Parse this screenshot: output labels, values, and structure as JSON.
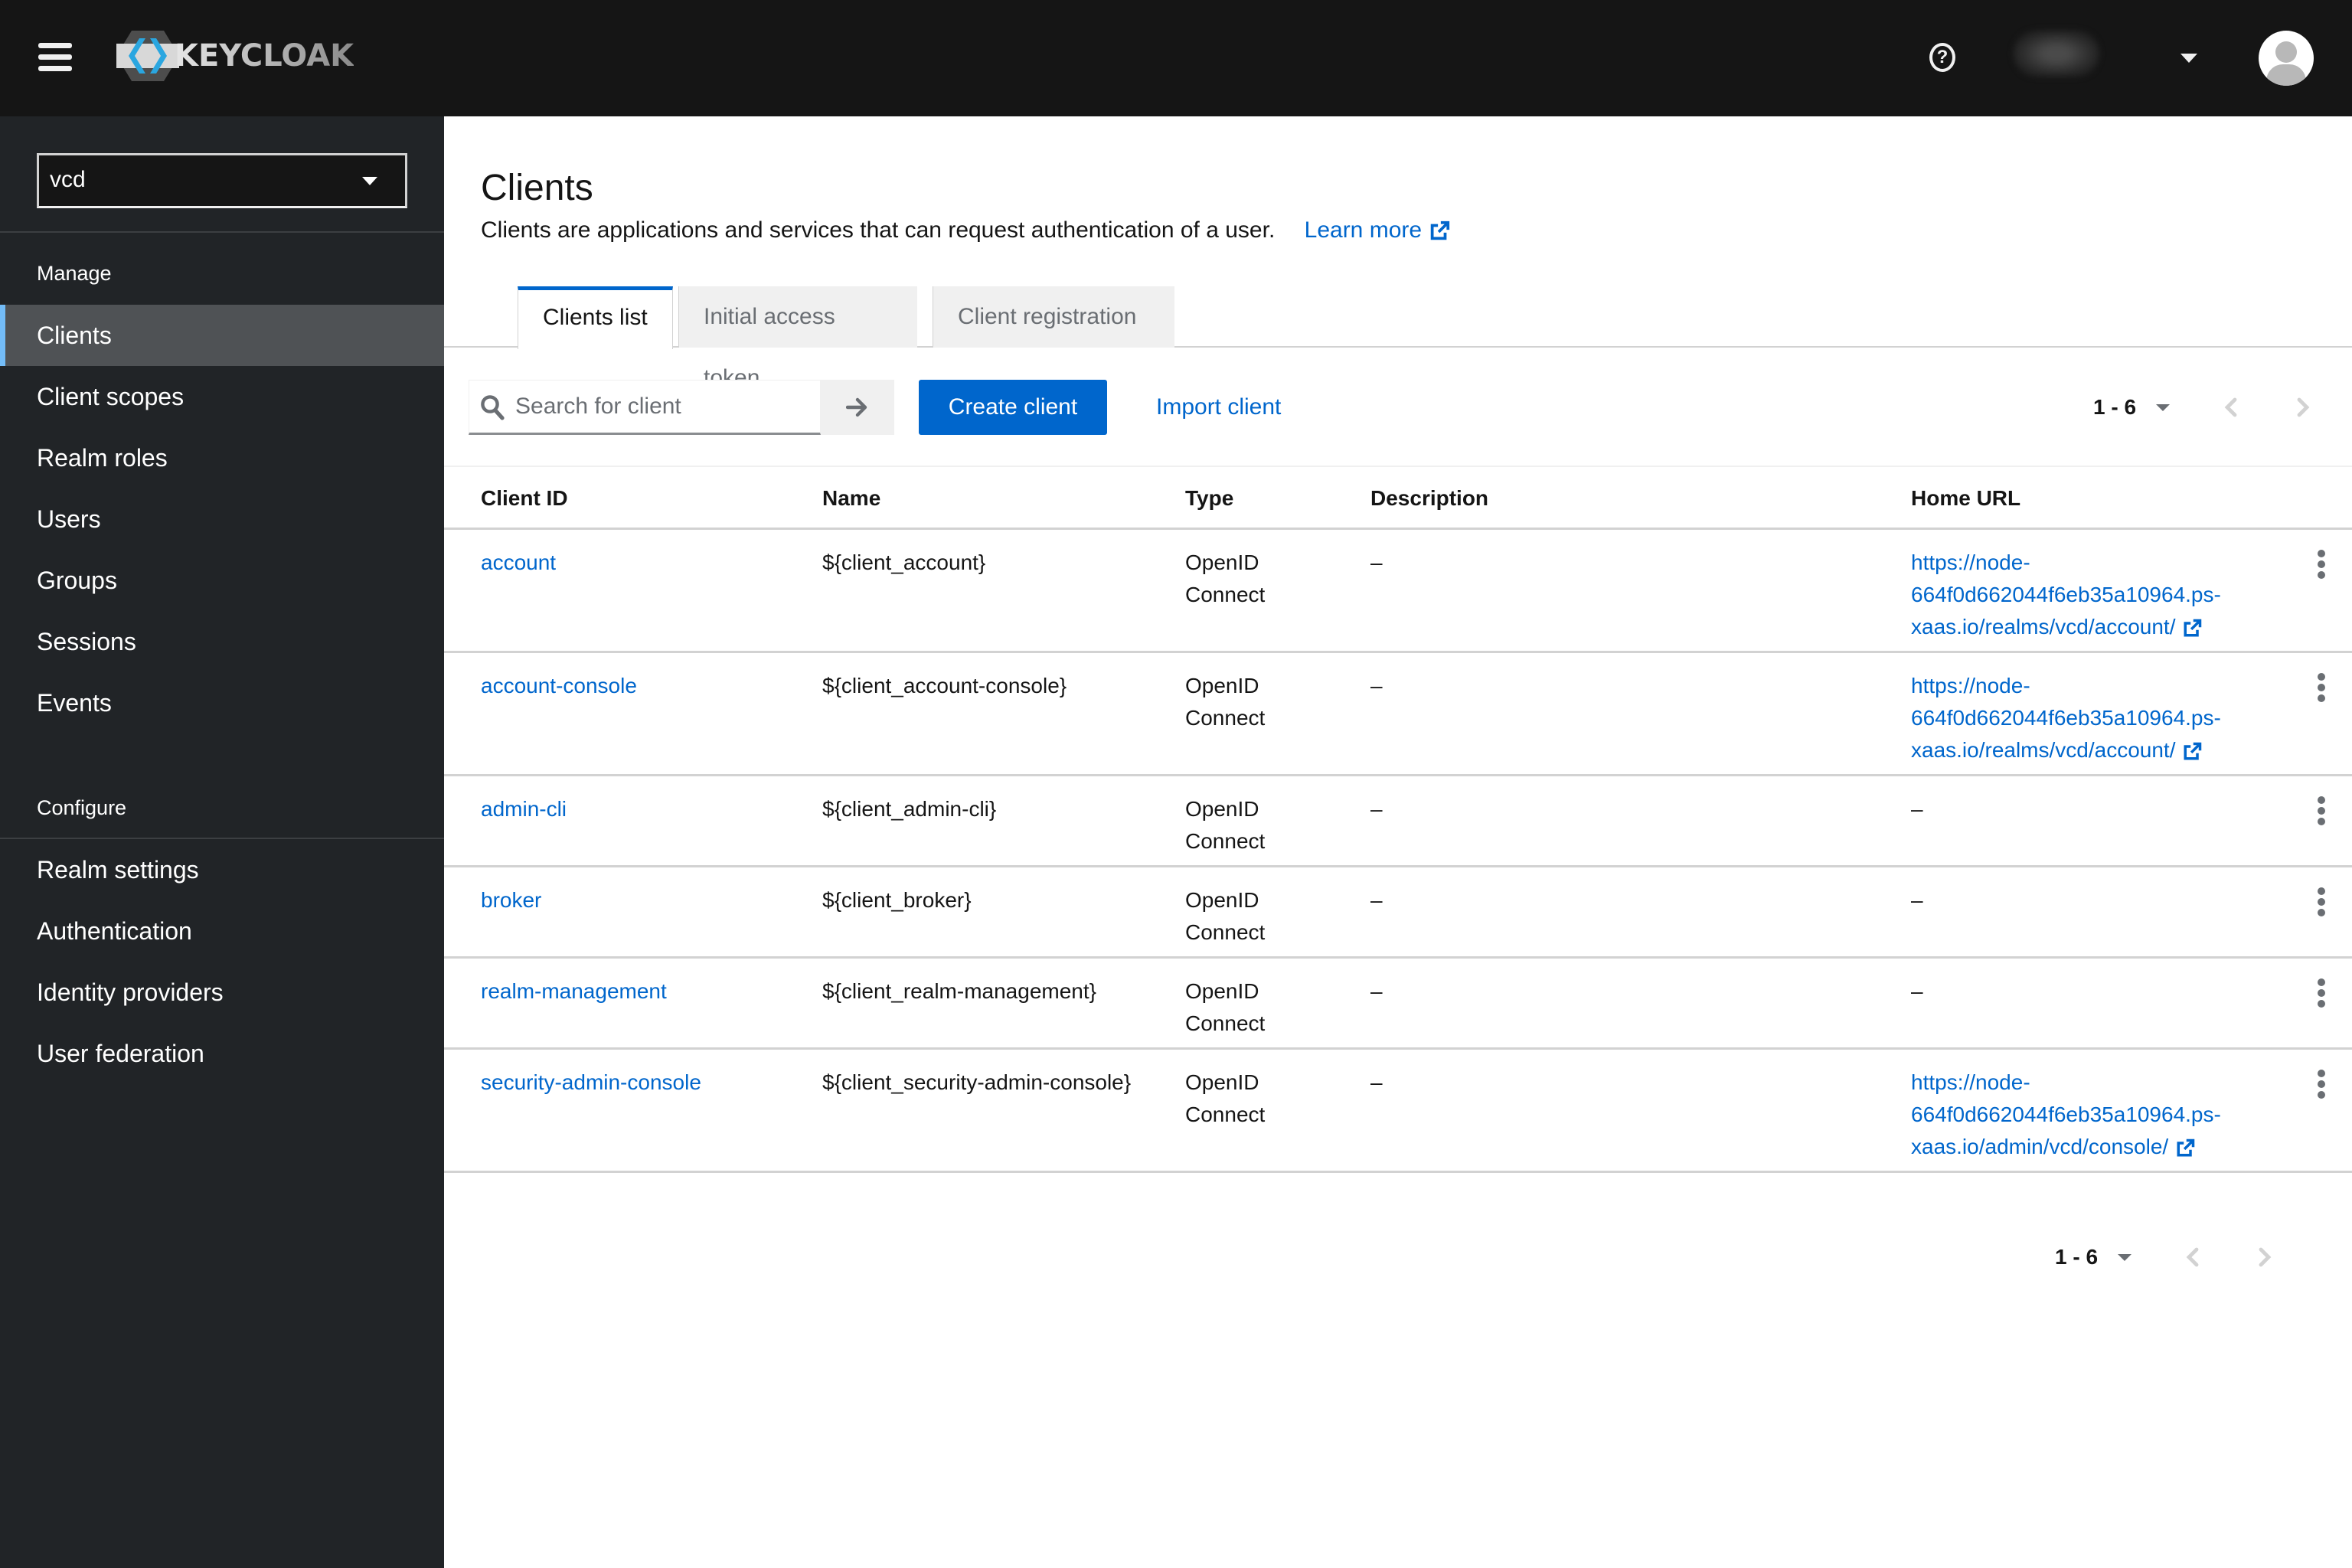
{
  "masthead": {
    "brand": "KEYCLOAK",
    "help_icon": "question-circle-icon",
    "user_name_blurred": true,
    "avatar_icon": "user-avatar-icon"
  },
  "sidebar": {
    "realm": "vcd",
    "groups": [
      {
        "title": "Manage",
        "items": [
          {
            "label": "Clients",
            "active": true
          },
          {
            "label": "Client scopes",
            "active": false
          },
          {
            "label": "Realm roles",
            "active": false
          },
          {
            "label": "Users",
            "active": false
          },
          {
            "label": "Groups",
            "active": false
          },
          {
            "label": "Sessions",
            "active": false
          },
          {
            "label": "Events",
            "active": false
          }
        ]
      },
      {
        "title": "Configure",
        "items": [
          {
            "label": "Realm settings",
            "active": false
          },
          {
            "label": "Authentication",
            "active": false
          },
          {
            "label": "Identity providers",
            "active": false
          },
          {
            "label": "User federation",
            "active": false
          }
        ]
      }
    ]
  },
  "page": {
    "title": "Clients",
    "description": "Clients are applications and services that can request authentication of a user.",
    "learn_more": "Learn more",
    "tabs": [
      {
        "label": "Clients list",
        "active": true
      },
      {
        "label": "Initial access token",
        "active": false
      },
      {
        "label": "Client registration",
        "active": false
      }
    ]
  },
  "toolbar": {
    "search_placeholder": "Search for client",
    "search_value": "",
    "create_label": "Create client",
    "import_label": "Import client",
    "pagination_range": "1 - 6"
  },
  "table": {
    "columns": [
      "Client ID",
      "Name",
      "Type",
      "Description",
      "Home URL"
    ],
    "rows": [
      {
        "client_id": "account",
        "name": "${client_account}",
        "type": "OpenID Connect",
        "description": "–",
        "home_url": "https://node-664f0d662044f6eb35a10964.ps-xaas.io/realms/vcd/account/",
        "url_lines": [
          "https://node-",
          "664f0d662044f6eb35a10964.ps-",
          "xaas.io/realms/vcd/account/"
        ]
      },
      {
        "client_id": "account-console",
        "name": "${client_account-console}",
        "type": "OpenID Connect",
        "description": "–",
        "home_url": "https://node-664f0d662044f6eb35a10964.ps-xaas.io/realms/vcd/account/",
        "url_lines": [
          "https://node-",
          "664f0d662044f6eb35a10964.ps-",
          "xaas.io/realms/vcd/account/"
        ]
      },
      {
        "client_id": "admin-cli",
        "name": "${client_admin-cli}",
        "type": "OpenID Connect",
        "description": "–",
        "home_url": "–",
        "url_lines": []
      },
      {
        "client_id": "broker",
        "name": "${client_broker}",
        "type": "OpenID Connect",
        "description": "–",
        "home_url": "–",
        "url_lines": []
      },
      {
        "client_id": "realm-management",
        "name": "${client_realm-management}",
        "type": "OpenID Connect",
        "description": "–",
        "home_url": "–",
        "url_lines": []
      },
      {
        "client_id": "security-admin-console",
        "name": "${client_security-admin-console}",
        "type": "OpenID Connect",
        "description": "–",
        "home_url": "https://node-664f0d662044f6eb35a10964.ps-xaas.io/admin/vcd/console/",
        "url_lines": [
          "https://node-",
          "664f0d662044f6eb35a10964.ps-",
          "xaas.io/admin/vcd/console/"
        ]
      }
    ]
  },
  "colors": {
    "masthead_bg": "#151515",
    "sidebar_bg": "#212427",
    "sidebar_active_bg": "#4f5255",
    "sidebar_active_accent": "#73bcf7",
    "primary": "#0066cc",
    "border": "#d2d2d2"
  }
}
